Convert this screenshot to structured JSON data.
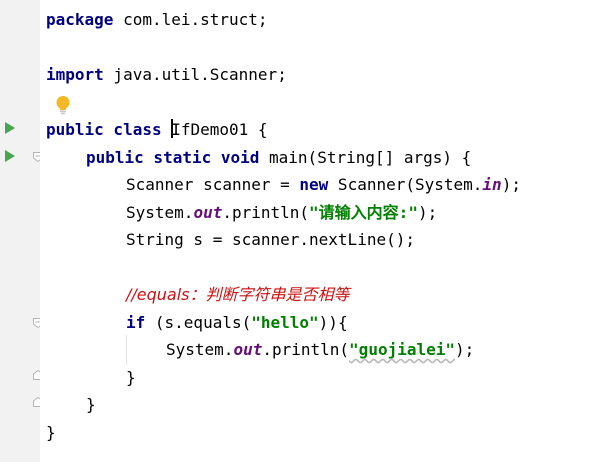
{
  "editor": {
    "lines": {
      "l1": {
        "kw": "package",
        "rest": " com.lei.struct;"
      },
      "l2": {
        "kw": "import",
        "rest": " java.util.Scanner;"
      },
      "l3": {
        "kw": "public class ",
        "name": "IfDemo01",
        "rest": " {"
      },
      "l4": {
        "kw": "public static void",
        "rest": " main(String[] args) {"
      },
      "l5": {
        "pre": "Scanner scanner = ",
        "kw": "new",
        "mid": " Scanner(System.",
        "field": "in",
        "post": ");"
      },
      "l6": {
        "pre": "System.",
        "field": "out",
        "mid": ".println(",
        "str": "\"请输入内容:\"",
        "post": ");"
      },
      "l7": {
        "text": "String s = scanner.nextLine();"
      },
      "l8": {
        "comment": "//equals：判断字符串是否相等"
      },
      "l9": {
        "kw": "if",
        "mid": " (s.equals(",
        "str": "\"hello\"",
        "post": ")){"
      },
      "l10": {
        "pre": "System.",
        "field": "out",
        "mid": ".println(",
        "str": "\"guojialei\"",
        "post": ");"
      },
      "l11": {
        "text": "}"
      },
      "l12": {
        "text": "}"
      },
      "l13": {
        "text": "}"
      }
    }
  },
  "icons": {
    "run": "run-gutter-icon",
    "fold": "fold-marker-icon",
    "intention": "lightbulb-icon"
  },
  "colors": {
    "keyword": "#000080",
    "string": "#008000",
    "field": "#660e7a",
    "comment": "#cc1111",
    "run_icon": "#4aa552",
    "gutter": "#f2f2f2"
  }
}
